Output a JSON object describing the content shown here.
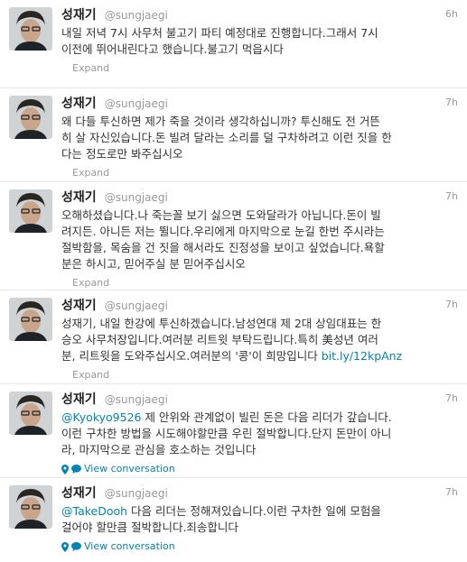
{
  "tweets": [
    {
      "name": "성재기",
      "handle": "@sungjaegi",
      "time": "6h",
      "lines": [
        "내일 저녁 7시 사무처 불고기 파티 예정대로 진행합니다.그래서 7시",
        "이전에 뛰어내린다고 했습니다.불고기 먹읍시다"
      ],
      "footer": "Expand"
    },
    {
      "name": "성재기",
      "handle": "@sungjaegi",
      "time": "7h",
      "lines": [
        "왜 다들 투신하면 제가 죽을 것이라 생각하십니까? 투신해도 전 거뜬",
        "히 살 자신있습니다.돈 빌려 달라는 소리를 덜 구차하려고 이런 짓을 한",
        "다는 정도로만 봐주십시오"
      ],
      "footer": "Expand"
    },
    {
      "name": "성재기",
      "handle": "@sungjaegi",
      "time": "7h",
      "lines": [
        "오해하셨습니다.나 죽는꼴 보기 싫으면 도와달라가 아닙니다.돈이 빌",
        "려지든. 아니든 저는 뛸니다.우리에게 마지막으로 눈길 한번 주시라는",
        "절박함을, 목숨을 건 짓을 해서라도  진정성을 보이고 싶었습니다.욕할",
        "분은 하시고, 믿어주실 분 믿어주십시오"
      ],
      "footer": "Expand"
    },
    {
      "name": "성재기",
      "handle": "@sungjaegi",
      "time": "7h",
      "lines": [
        "성재기, 내일 한강에 투신하겠습니다.남성연대 제 2대 상임대표는 한",
        "승오 사무처장입니다.여러분 리트윗 부탁드립니다.특히 美성년 여러",
        "분, 리트윗을 도와주십시오.여러분의 '콩'이 희망입니다 "
      ],
      "link": "bit.ly/12kpAnz",
      "footer": "Expand"
    },
    {
      "name": "성재기",
      "handle": "@sungjaegi",
      "time": "7h",
      "mention": "@Kyokyo9526",
      "lines": [
        " 제 안위와 관계없이 빌린 돈은 다음 리더가 갚습니다.",
        "이런 구차한 방법을 시도해야할만큼 우린 절박합니다.단지 돈만이 아니",
        "라, 마지막으로 관심을 호소하는 것입니다"
      ],
      "footer": "View conversation"
    },
    {
      "name": "성재기",
      "handle": "@sungjaegi",
      "time": "7h",
      "mention": "@TakeDooh",
      "lines": [
        " 다음 리더는 정해져있습니다.이런 구차한 일에 모험을",
        "걸어야 할만큼 절박합니다.죄송합니다"
      ],
      "footer": "View conversation"
    }
  ]
}
